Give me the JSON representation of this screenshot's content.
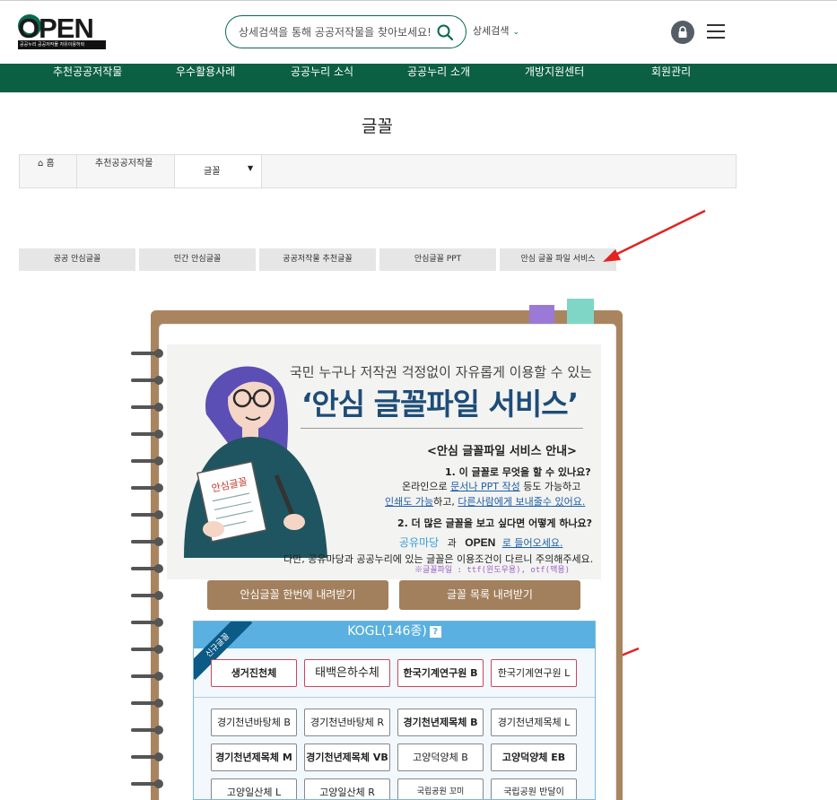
{
  "header": {
    "logo_word": "OPEN",
    "logo_tag": "공공누리  공공저작물 자유이용허락",
    "search_placeholder": "상세검색을 통해 공공저작물을 찾아보세요!!",
    "advanced_search": "상세검색"
  },
  "nav": [
    "추천공공저작물",
    "우수활용사례",
    "공공누리 소식",
    "공공누리 소개",
    "개방지원센터",
    "회원관리"
  ],
  "page_title": "글꼴",
  "breadcrumb": {
    "home": "홈",
    "level1": "추천공공저작물",
    "level2": "글꼴"
  },
  "tabs": [
    "공공 안심글꼴",
    "민간 안심글꼴",
    "공공저작물 추천글꼴",
    "안심글꼴 PPT",
    "안심 글꼴 파일 서비스"
  ],
  "banner": {
    "headline_small": "국민 누구나 저작권 걱정없이 자유롭게 이용할 수 있는",
    "headline_big": "‘안심 글꼴파일 서비스’",
    "paper_label": "안심글꼴",
    "guide_title": "<안심 글꼴파일 서비스 안내>",
    "q1": "1. 이 글꼴로 무엇을 할 수 있나요?",
    "a1_pre": "온라인으로 ",
    "a1_link": "문서나 PPT 작성",
    "a1_post": " 등도 가능하고",
    "a2_link1": "인쇄도 가능",
    "a2_mid": "하고, ",
    "a2_link2": "다른사람에게 보내줄수 있어요.",
    "q2": "2. 더 많은 글꼴을 보고 싶다면 어떻게 하나요?",
    "gongyu_logo": "공유마당",
    "and_word": "과",
    "open_logo": "OPEN",
    "enter_link": "로 들어오세요.",
    "caution": "다만, 공유마당과 공공누리에 있는 글꼴은 이용조건이 다르니 주의해주세요.",
    "note": "※글꼴파일 : ttf(윈도우용), otf(맥용)"
  },
  "downloads": {
    "all": "안심글꼴 한번에 내려받기",
    "list": "글꼴 목록 내려받기"
  },
  "kogl": {
    "title": "KOGL(146종)",
    "help": "?",
    "ribbon": "신규글꼴",
    "new_fonts": [
      "생거진천체",
      "태백은하수체",
      "한국기계연구원 B",
      "한국기계연구원 L"
    ],
    "fonts": [
      "경기천년바탕체 B",
      "경기천년바탕체 R",
      "경기천년제목체 B",
      "경기천년제목체 L",
      "경기천년제목체 M",
      "경기천년제목체 VB",
      "고양덕양체 B",
      "고양덕양체 EB",
      "고양일산체 L",
      "고양일산체 R",
      "국립공원 꼬미",
      "국립공원 반달이"
    ]
  }
}
